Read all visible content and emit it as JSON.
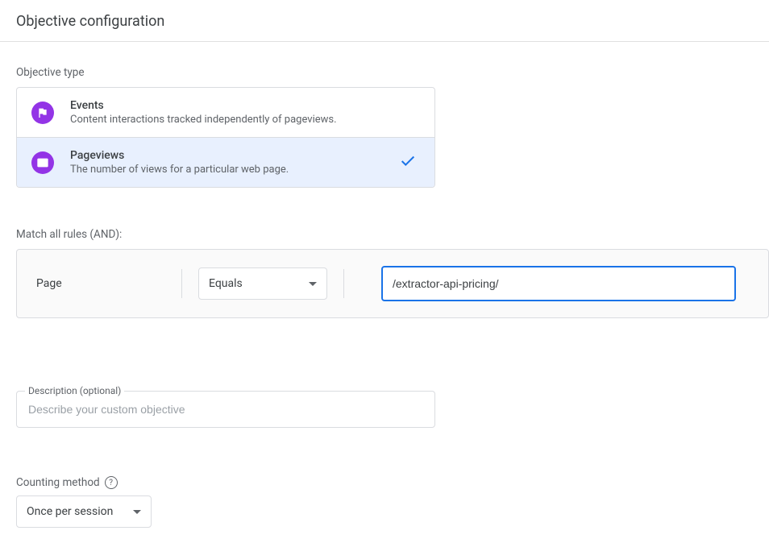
{
  "header": {
    "title": "Objective configuration"
  },
  "objective_type": {
    "label": "Objective type",
    "options": [
      {
        "key": "events",
        "title": "Events",
        "description": "Content interactions tracked independently of pageviews.",
        "selected": false
      },
      {
        "key": "pageviews",
        "title": "Pageviews",
        "description": "The number of views for a particular web page.",
        "selected": true
      }
    ]
  },
  "rules": {
    "label": "Match all rules (AND):",
    "field_label": "Page",
    "operator": "Equals",
    "value": "/extractor-api-pricing/"
  },
  "description": {
    "float_label": "Description (optional)",
    "placeholder": "Describe your custom objective",
    "value": ""
  },
  "counting": {
    "label": "Counting method",
    "help_glyph": "?",
    "selected": "Once per session"
  }
}
